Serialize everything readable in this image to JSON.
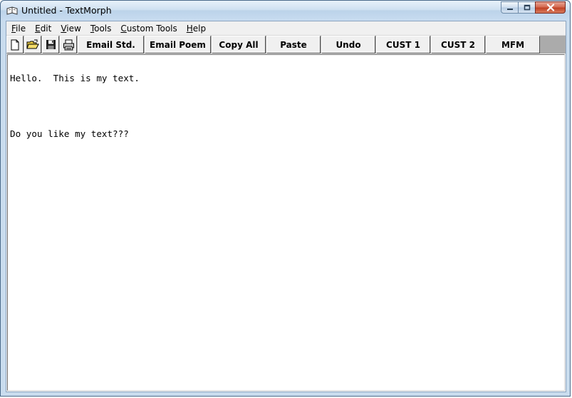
{
  "window": {
    "title": "Untitled - TextMorph"
  },
  "icons": {
    "app": "book-icon",
    "minimize": "minimize-icon",
    "maximize": "maximize-icon",
    "close": "close-icon",
    "new": "new-document-icon",
    "open": "open-folder-icon",
    "save": "floppy-disk-icon",
    "print": "printer-icon"
  },
  "menu": {
    "items": [
      {
        "pre": "",
        "u": "F",
        "post": "ile"
      },
      {
        "pre": "",
        "u": "E",
        "post": "dit"
      },
      {
        "pre": "",
        "u": "V",
        "post": "iew"
      },
      {
        "pre": "",
        "u": "T",
        "post": "ools"
      },
      {
        "pre": "",
        "u": "C",
        "post": "ustom Tools"
      },
      {
        "pre": "",
        "u": "H",
        "post": "elp"
      }
    ]
  },
  "toolbar": {
    "buttons": [
      "Email Std.",
      "Email Poem",
      "Copy All",
      "Paste",
      "Undo",
      "CUST 1",
      "CUST 2",
      "MFM"
    ]
  },
  "editor": {
    "lines": [
      "Hello.  This is my text.",
      "",
      "Do you like my text???"
    ]
  },
  "colors": {
    "accent_close": "#c04226",
    "titlebar": "#c9dcee"
  }
}
